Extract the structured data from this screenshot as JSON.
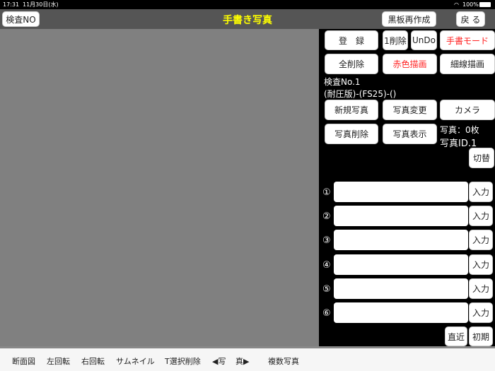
{
  "status": {
    "time": "17:31",
    "date": "11月30日(水)",
    "battery": "100%"
  },
  "nav": {
    "title": "手書き写真",
    "left_button": "検査NO",
    "blackboard_button": "黒板再作成",
    "back_button": "戻 る",
    "title_color": "#ffff00"
  },
  "panel": {
    "register": "登　録",
    "delete_one": "1削除",
    "undo": "UnDo",
    "handwrite_mode": "手書モード",
    "delete_all": "全削除",
    "red_draw": "赤色描画",
    "thin_draw": "細線描画",
    "inspection_no": "検査No.1",
    "inspection_desc": "(耐圧版)-(FS25)-()",
    "new_photo": "新規写真",
    "change_photo": "写真変更",
    "camera": "カメラ",
    "delete_photo": "写真削除",
    "show_photo": "写真表示",
    "photo_count": "写真：0枚",
    "photo_id": "写真ID.1",
    "switch": "切替",
    "inputs": [
      {
        "num": "①",
        "value": "",
        "button": "入力"
      },
      {
        "num": "②",
        "value": "",
        "button": "入力"
      },
      {
        "num": "③",
        "value": "",
        "button": "入力"
      },
      {
        "num": "④",
        "value": "",
        "button": "入力"
      },
      {
        "num": "⑤",
        "value": "",
        "button": "入力"
      },
      {
        "num": "⑥",
        "value": "",
        "button": "入力"
      }
    ],
    "recent": "直近",
    "initial": "初期"
  },
  "toolbar": [
    "断面図",
    "左回転",
    "右回転",
    "サムネイル",
    "T選択削除",
    "◀写",
    "真▶",
    "複数写真"
  ]
}
